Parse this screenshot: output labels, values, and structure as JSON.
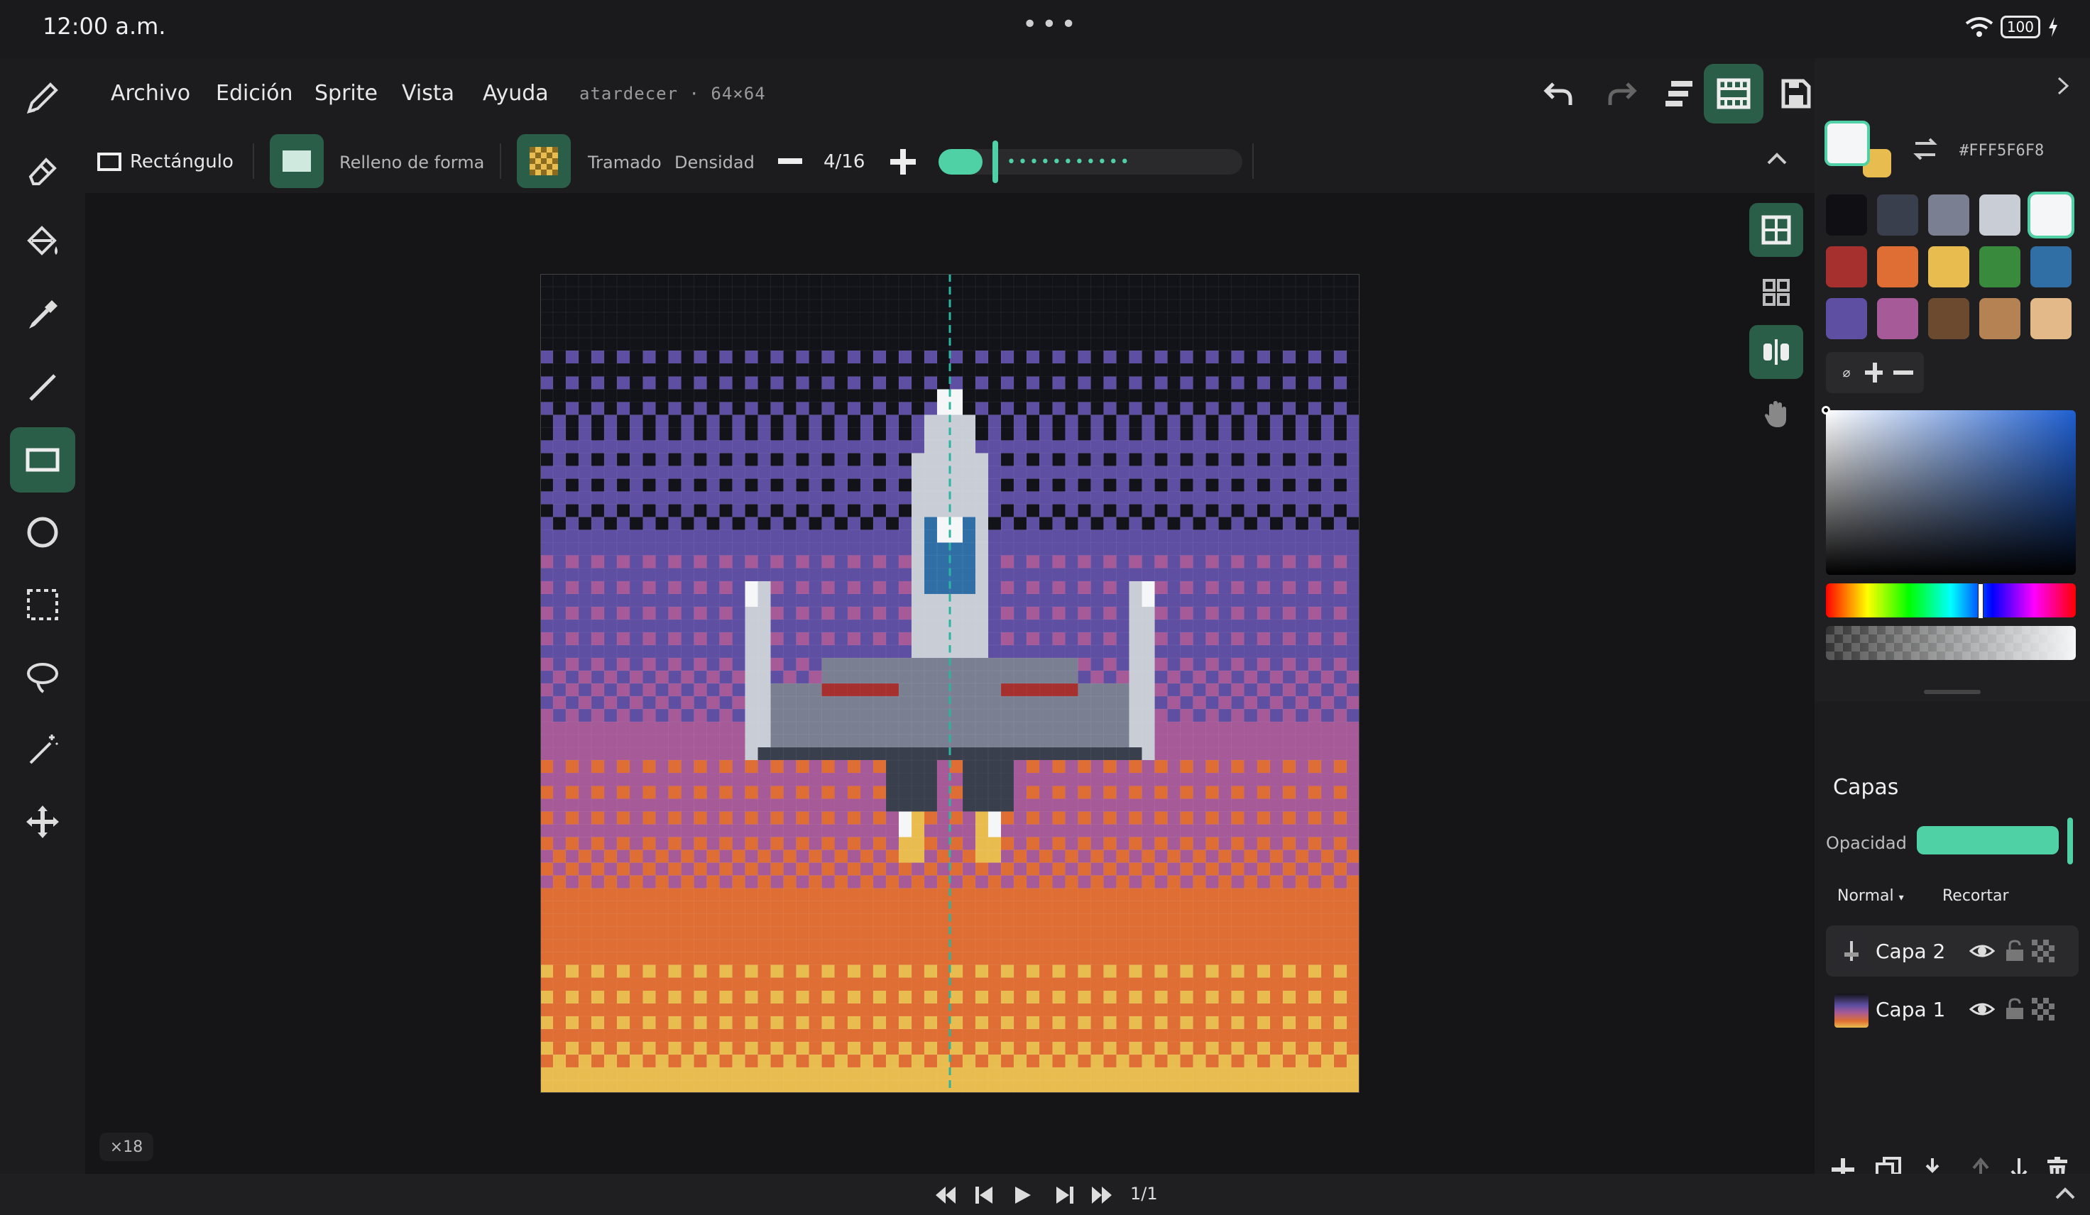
{
  "status": {
    "time": "12:00 a.m.",
    "battery": "100"
  },
  "menu": {
    "items": [
      "Archivo",
      "Edición",
      "Sprite",
      "Vista",
      "Ayuda"
    ],
    "filename": "atardecer · 64×64"
  },
  "options": {
    "tool_name": "Rectángulo",
    "fill_label": "Relleno de forma",
    "dither_label": "Tramado",
    "density_label": "Densidad",
    "density_value": "4/16"
  },
  "canvas": {
    "zoom": "×18",
    "grid_size": 64,
    "sky_colors": {
      "night": "#121318",
      "purple": "#5f4fa3",
      "magenta": "#a65a98",
      "orange": "#de6e34",
      "yellow": "#e9bc4f"
    }
  },
  "color": {
    "primary": "#F5F6F8",
    "secondary": "#e9bc4f",
    "hex_label": "#FFF5F6F8"
  },
  "palette": [
    "#101014",
    "#3a3f4d",
    "#7a8092",
    "#c8cdd6",
    "#f5f6f8",
    "#a6302e",
    "#de6e34",
    "#e9bc4f",
    "#3a8a3e",
    "#2f6fa6",
    "#5f4fa3",
    "#a65a98",
    "#6b4a30",
    "#b58254",
    "#e3b98a"
  ],
  "layers": {
    "title": "Capas",
    "opacity_label": "Opacidad",
    "blend_mode": "Normal",
    "clip_label": "Recortar",
    "items": [
      {
        "name": "Capa 2"
      },
      {
        "name": "Capa 1"
      }
    ]
  },
  "playback": {
    "frame": "1/1"
  }
}
